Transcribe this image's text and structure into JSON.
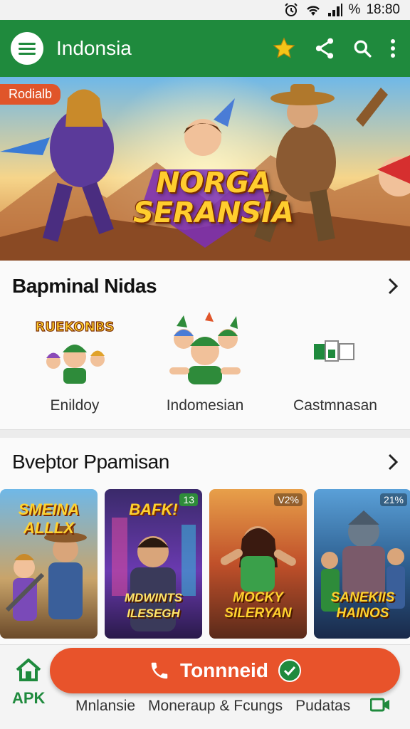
{
  "status": {
    "time": "18:80",
    "battery_text": "%"
  },
  "app_bar": {
    "title": "Indonsia",
    "icons": [
      "menu-icon",
      "star-icon",
      "share-icon",
      "search-icon",
      "more-vert-icon"
    ]
  },
  "banner": {
    "tag": "Rodialb",
    "title_line1": "NORGA",
    "title_line2": "SERANSIA"
  },
  "section1": {
    "title": "Bapminal Nidas",
    "items": [
      {
        "label": "Enildoy",
        "art_text": "RUEKONBS"
      },
      {
        "label": "Indomesian"
      },
      {
        "label": "Castmnasan"
      }
    ]
  },
  "section2": {
    "title": "Bveþtor Ppamisan",
    "games": [
      {
        "top": "SMEINA ALLLX",
        "bottom": "",
        "badge": ""
      },
      {
        "top": "BAFK!",
        "bottom": "MDWINTS ILESEGH",
        "badge": "13"
      },
      {
        "top": "",
        "bottom": "MOCKY SILERYAN",
        "badge": "V2%"
      },
      {
        "top": "",
        "bottom": "SANEKIIS HAINOS",
        "badge": "21%"
      }
    ]
  },
  "bottom": {
    "cta_label": "Tonnneid",
    "apk_label": "APK",
    "links": [
      "Mnlansie",
      "Moneraup & Fcungs",
      "Pudatas"
    ]
  },
  "colors": {
    "primary": "#1f8a3d",
    "accent": "#e8532b",
    "star": "#f5c518"
  }
}
